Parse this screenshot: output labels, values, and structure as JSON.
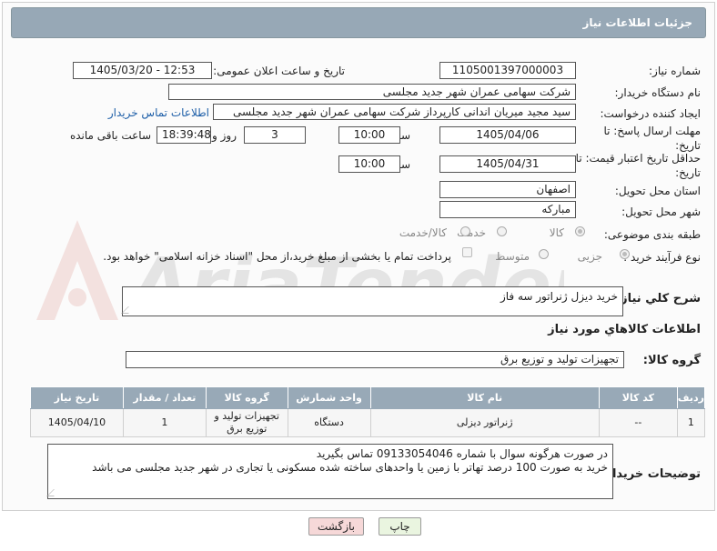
{
  "header": {
    "title": "جزئیات اطلاعات نیاز"
  },
  "fields": {
    "need_number_label": "شماره نیاز:",
    "need_number": "1105001397000003",
    "announce_label": "تاریخ و ساعت اعلان عمومی:",
    "announce_value": "1405/03/20 - 12:53",
    "buyer_org_label": "نام دستگاه خریدار:",
    "buyer_org": "شرکت سهامی عمران شهر جدید مجلسی",
    "requester_label": "ایجاد کننده درخواست:",
    "requester": "سید مجید  میریان اندانی کارپرداز شرکت سهامی عمران شهر جدید مجلسی",
    "contact_link": "اطلاعات تماس خریدار",
    "send_deadline_label": "مهلت ارسال پاسخ: تا تاریخ:",
    "send_date": "1405/04/06",
    "hour_label": "ساعت",
    "send_time": "10:00",
    "days": "3",
    "days_label": "روز و",
    "remaining_time": "18:39:48",
    "remaining_label": "ساعت باقی مانده",
    "price_validity_label": "حداقل تاریخ اعتبار قیمت: تا تاریخ:",
    "price_date": "1405/04/31",
    "price_hour_label": "ساعت",
    "price_time": "10:00",
    "province_label": "استان محل تحویل:",
    "province": "اصفهان",
    "city_label": "شهر محل تحویل:",
    "city": "مبارکه",
    "category_label": "طبقه بندی موضوعی:",
    "category_options": [
      "کالا",
      "خدمت",
      "کالا/خدمت"
    ],
    "purchase_type_label": "نوع فرآیند خرید :",
    "purchase_options": [
      "جزیی",
      "متوسط"
    ],
    "payment_note": "پرداخت تمام یا بخشی از مبلغ خرید،از محل \"اسناد خزانه اسلامی\" خواهد بود."
  },
  "summary": {
    "label": "شرح کلي نياز:",
    "value": "خرید دیزل ژنراتور سه فاز"
  },
  "items_section": {
    "title": "اطلاعات کالاهاي مورد نياز",
    "group_label": "گروه کالا:",
    "group_value": "تجهیزات تولید و توزیع برق",
    "columns": [
      "ردیف",
      "کد کالا",
      "نام کالا",
      "واحد شمارش",
      "گروه کالا",
      "تعداد / مقدار",
      "تاریخ نیاز"
    ],
    "rows": [
      [
        "1",
        "--",
        "ژنراتور دیزلی",
        "دستگاه",
        "تجهیزات تولید و توزیع برق",
        "1",
        "1405/04/10"
      ]
    ]
  },
  "buyer_notes": {
    "label": "توضیحات خریدار:",
    "line1": "در صورت هرگونه سوال با شماره 09133054046 تماس بگیرید",
    "line2": "خرید به صورت 100 درصد تهاتر با زمین یا واحدهای ساخته شده مسکونی یا تجاری در شهر جدید مجلسی می باشد"
  },
  "buttons": {
    "print": "چاپ",
    "back": "بازگشت"
  },
  "watermark": {
    "text": "AriaTender.net"
  },
  "colors": {
    "header_bg": "#97a8b6",
    "link": "#1e5fa8",
    "back_button": "#f6d8d8",
    "print_button": "#eaf5e0"
  }
}
